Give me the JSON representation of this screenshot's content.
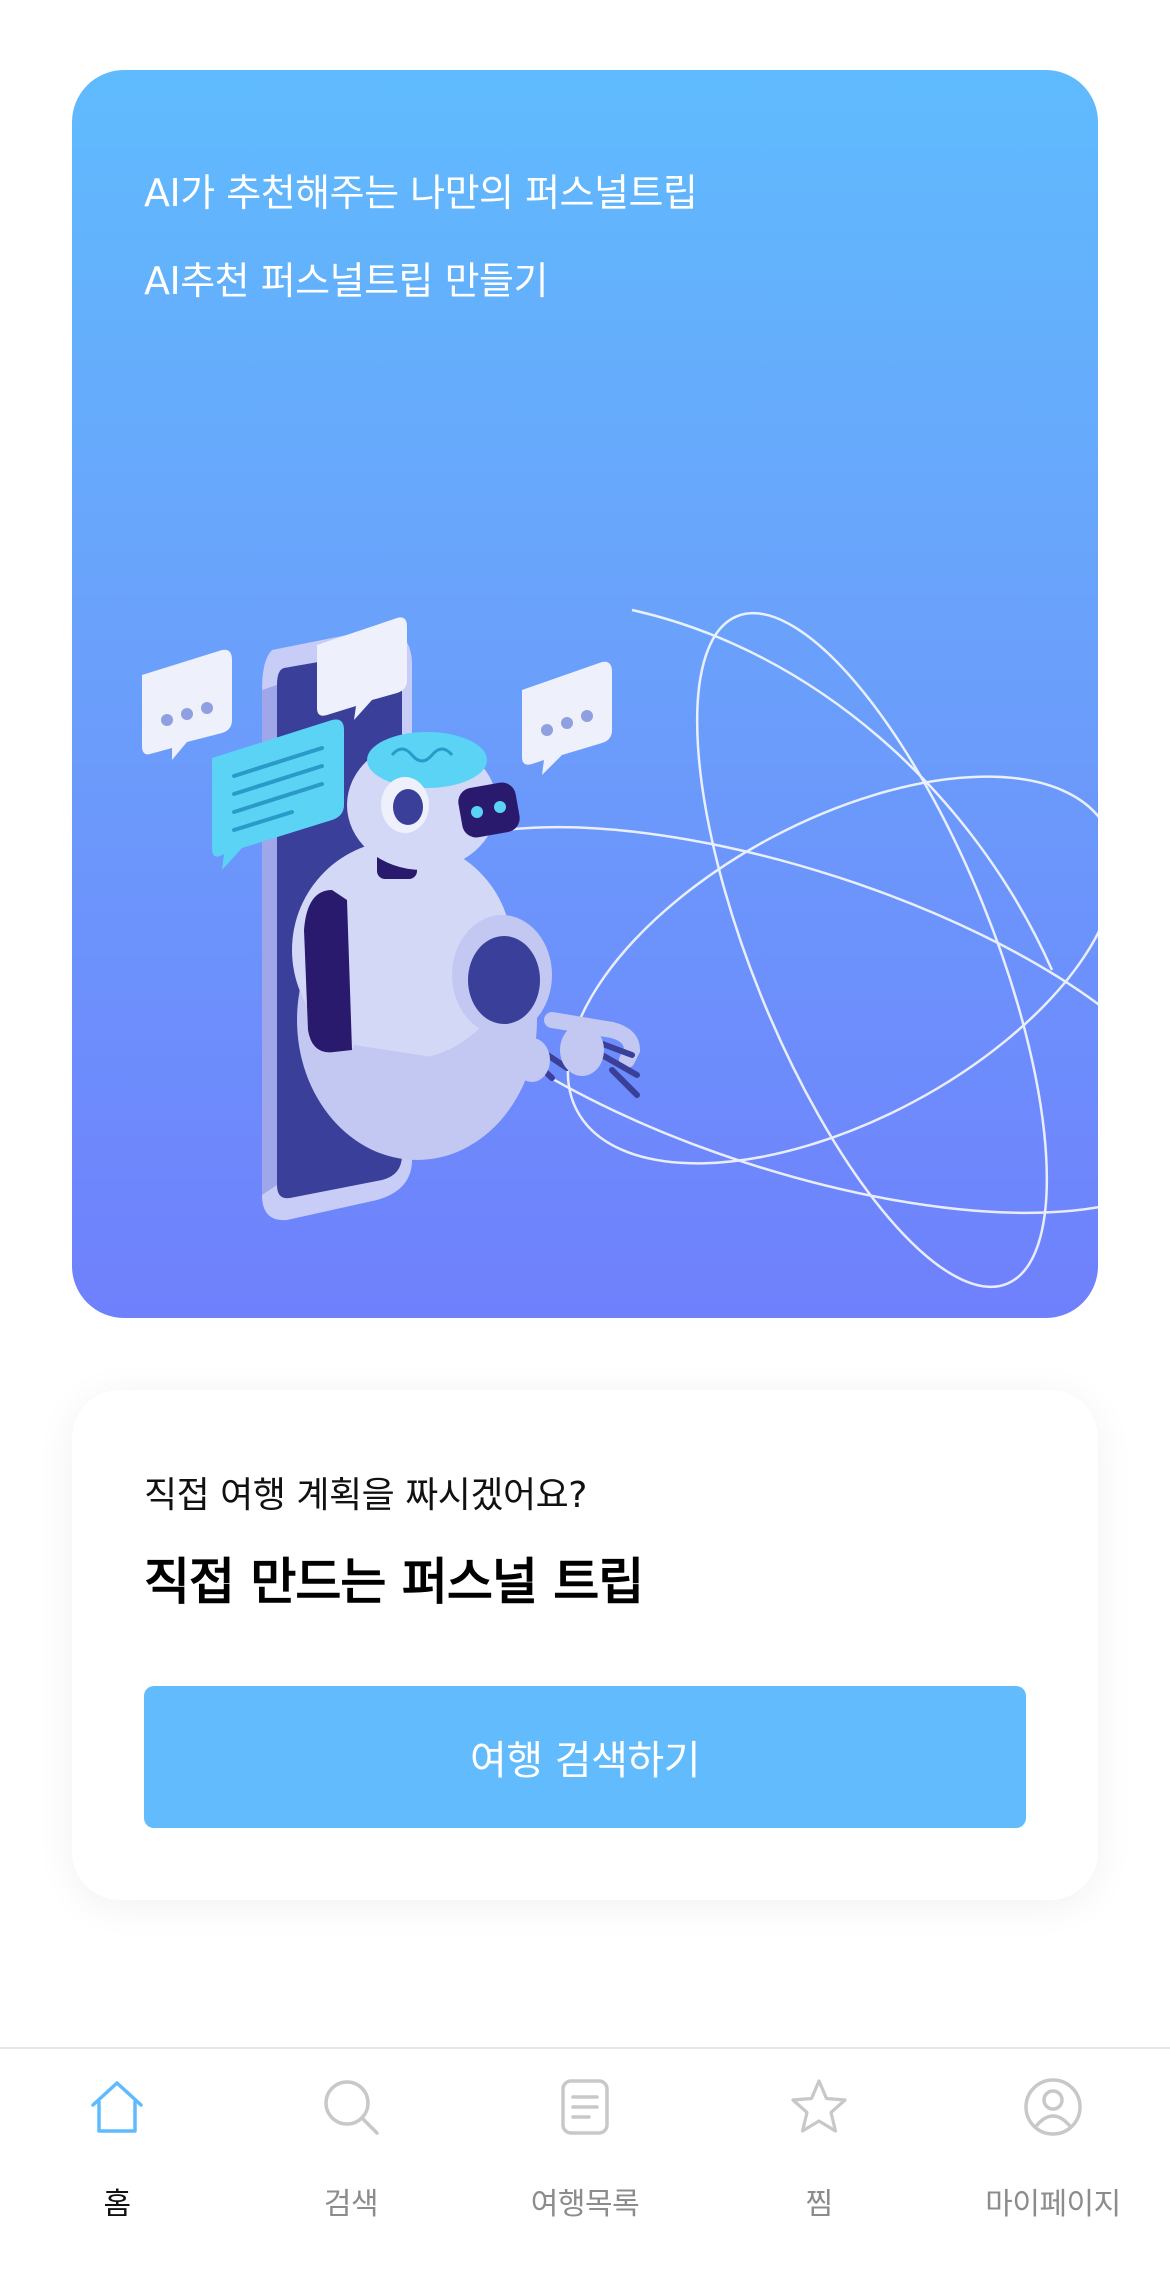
{
  "ai_card": {
    "subtitle": "AI가 추천해주는 나만의 퍼스널트립",
    "title": "AI추천 퍼스널트립 만들기"
  },
  "manual_card": {
    "subtitle": "직접 여행 계획을 짜시겠어요?",
    "title": "직접 만드는 퍼스널 트립",
    "button_label": "여행 검색하기"
  },
  "bottom_nav": {
    "items": [
      {
        "label": "홈",
        "icon": "home-icon",
        "active": true
      },
      {
        "label": "검색",
        "icon": "search-icon",
        "active": false
      },
      {
        "label": "여행목록",
        "icon": "document-icon",
        "active": false
      },
      {
        "label": "찜",
        "icon": "star-icon",
        "active": false
      },
      {
        "label": "마이페이지",
        "icon": "profile-icon",
        "active": false
      }
    ]
  },
  "colors": {
    "accent": "#62bbfd",
    "card_gradient_top": "#5fbbfd",
    "card_gradient_bottom": "#6f80fc",
    "active_icon": "#5fbbfd",
    "inactive_icon": "#c8c8c8"
  }
}
